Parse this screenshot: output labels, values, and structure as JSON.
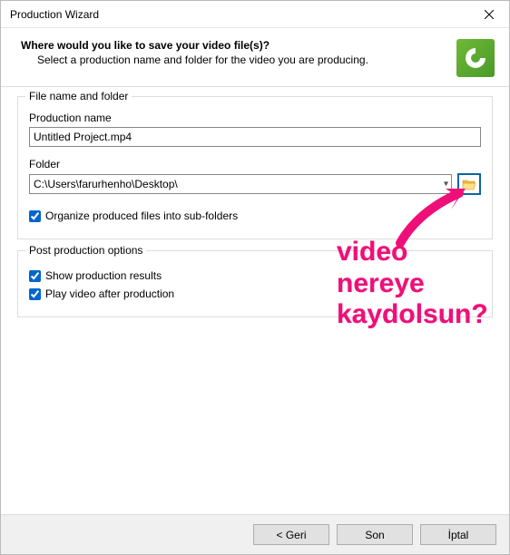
{
  "window": {
    "title": "Production Wizard"
  },
  "header": {
    "title": "Where would you like to save your video file(s)?",
    "subtitle": "Select a production name and folder for the video you are producing."
  },
  "group_file": {
    "legend": "File name and folder",
    "name_label": "Production name",
    "name_value": "Untitled Project.mp4",
    "folder_label": "Folder",
    "folder_value": "C:\\Users\\farurhenho\\Desktop\\",
    "organize_label": "Organize produced files into sub-folders",
    "organize_checked": true
  },
  "group_post": {
    "legend": "Post production options",
    "show_label": "Show production results",
    "show_checked": true,
    "play_label": "Play video after production",
    "play_checked": true
  },
  "footer": {
    "back": "< Geri",
    "finish": "Son",
    "cancel": "İptal"
  },
  "annotation": {
    "line1": "video",
    "line2": "nereye",
    "line3": "kaydolsun?"
  }
}
